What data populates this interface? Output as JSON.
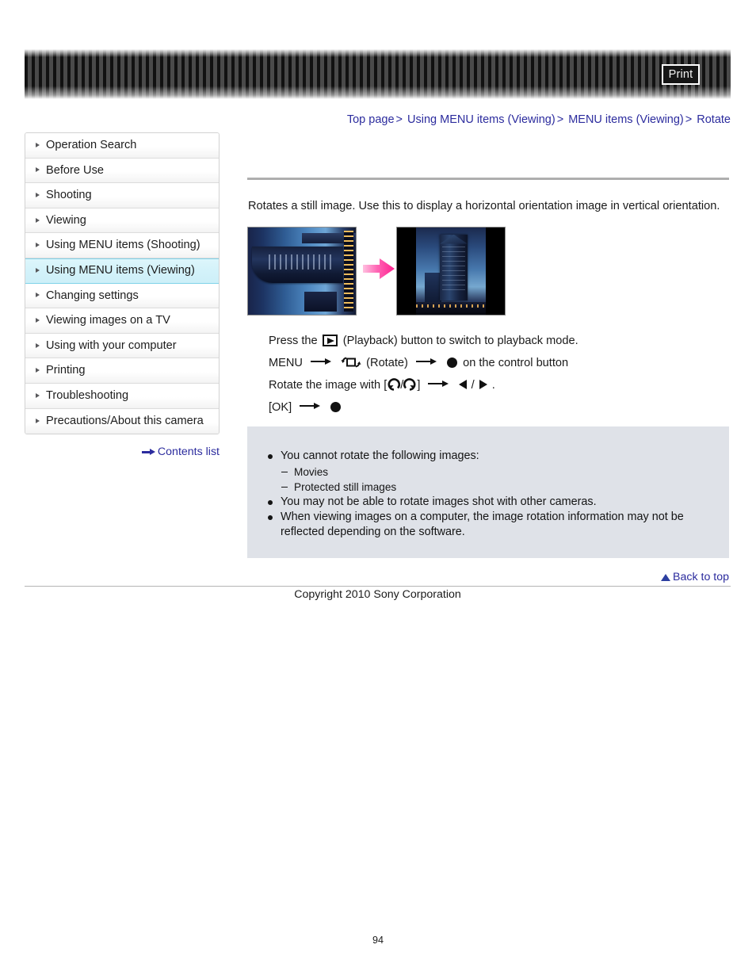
{
  "header": {
    "print_label": "Print"
  },
  "breadcrumb": {
    "items": [
      {
        "label": "Top page"
      },
      {
        "label": "Using MENU items (Viewing)"
      },
      {
        "label": "MENU items (Viewing)"
      },
      {
        "label": "Rotate"
      }
    ],
    "separator": ">"
  },
  "sidebar": {
    "items": [
      {
        "label": "Operation Search",
        "active": false
      },
      {
        "label": "Before Use",
        "active": false
      },
      {
        "label": "Shooting",
        "active": false
      },
      {
        "label": "Viewing",
        "active": false
      },
      {
        "label": "Using MENU items (Shooting)",
        "active": false
      },
      {
        "label": "Using MENU items (Viewing)",
        "active": true
      },
      {
        "label": "Changing settings",
        "active": false
      },
      {
        "label": "Viewing images on a TV",
        "active": false
      },
      {
        "label": "Using with your computer",
        "active": false
      },
      {
        "label": "Printing",
        "active": false
      },
      {
        "label": "Troubleshooting",
        "active": false
      },
      {
        "label": "Precautions/About this camera",
        "active": false
      }
    ],
    "contents_list_label": "Contents list"
  },
  "main": {
    "description": "Rotates a still image. Use this to display a horizontal orientation image in vertical orientation.",
    "illustration": {
      "before_caption": "horizontal orientation image of a skyscraper rotated sideways",
      "after_caption": "same skyscraper image displayed in vertical orientation with black side bars",
      "arrow_color": "#ff4da6"
    },
    "steps": [
      {
        "prefix": "Press the",
        "suffix": "(Playback) button to switch to playback mode."
      },
      {
        "menu_label": "MENU",
        "rotate_label": "(Rotate)",
        "tail_label": "on the control button"
      },
      {
        "prefix": "Rotate the image with [",
        "middle": "/",
        "after_bracket": "]",
        "slash": "/",
        "period": "."
      },
      {
        "ok_label": "[OK]"
      }
    ]
  },
  "notes": {
    "items": [
      {
        "type": "bullet",
        "text": "You cannot rotate the following images:"
      },
      {
        "type": "sub",
        "text": "Movies"
      },
      {
        "type": "sub",
        "text": "Protected still images"
      },
      {
        "type": "bullet",
        "text": "You may not be able to rotate images shot with other cameras."
      },
      {
        "type": "bullet",
        "text": "When viewing images on a computer, the image rotation information may not be reflected depending on the software."
      }
    ],
    "background_color": "#dfe2e8"
  },
  "footer": {
    "back_to_top_label": "Back to top",
    "copyright": "Copyright 2010 Sony Corporation",
    "page_number": "94"
  },
  "colors": {
    "link": "#2c2c9e",
    "sidebar_active_bg": "#d3f2fa",
    "sidebar_active_border": "#7fd2e8",
    "rule": "#aeaeae"
  }
}
